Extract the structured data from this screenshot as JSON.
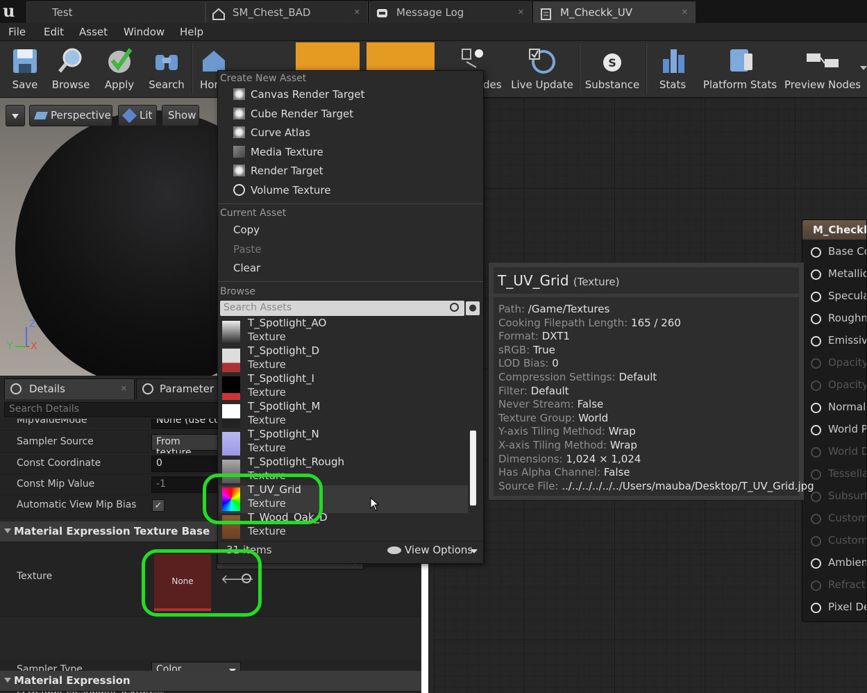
{
  "tabs": [
    {
      "label": "Test",
      "icon": "unreal-logo-icon"
    },
    {
      "label": "SM_Chest_BAD",
      "icon": "static-mesh-icon"
    },
    {
      "label": "Message Log",
      "icon": "message-log-icon"
    },
    {
      "label": "M_Checkk_UV",
      "icon": "material-icon"
    }
  ],
  "menu": [
    "File",
    "Edit",
    "Asset",
    "Window",
    "Help"
  ],
  "toolbar": {
    "save": "Save",
    "browse": "Browse",
    "apply": "Apply",
    "search": "Search",
    "home": "Hor",
    "nodes": "des",
    "live_update": "Live Update",
    "substance": "Substance",
    "stats": "Stats",
    "platform_stats": "Platform Stats",
    "preview_nodes": "Preview Nodes"
  },
  "viewport": {
    "perspective": "Perspective",
    "lit": "Lit",
    "show": "Show",
    "axis_z": "Z",
    "axis_y": "Y",
    "axis_x": "X"
  },
  "details": {
    "tab_details": "Details",
    "tab_params": "Parameter D",
    "search_placeholder": "Search Details",
    "rows": {
      "mip_value_mode": "MipValueMode",
      "mip_value_mode_val": "None (use co",
      "sampler_source": "Sampler Source",
      "sampler_source_val": "From texture",
      "const_coord": "Const Coordinate",
      "const_coord_val": "0",
      "const_mip": "Const Mip Value",
      "const_mip_val": "-1",
      "auto_mip": "Automatic View Mip Bias"
    },
    "section_texture_base": "Material Expression Texture Base",
    "texture_label": "Texture",
    "texture_thumb": "None",
    "texture_combo": "None",
    "sampler_type": "Sampler Type",
    "sampler_type_val": "Color",
    "default_meshpaint": "Is Default Meshpaint Texture",
    "section_expression": "Material Expression"
  },
  "picker": {
    "create_header": "Create New Asset",
    "create_items": [
      "Canvas Render Target",
      "Cube Render Target",
      "Curve Atlas",
      "Media Texture",
      "Render Target",
      "Volume Texture"
    ],
    "current_header": "Current Asset",
    "copy": "Copy",
    "paste": "Paste",
    "clear": "Clear",
    "browse_header": "Browse",
    "search_placeholder": "Search Assets",
    "assets": [
      {
        "name": "T_Spotlight_AO",
        "type": "Texture"
      },
      {
        "name": "T_Spotlight_D",
        "type": "Texture"
      },
      {
        "name": "T_Spotlight_I",
        "type": "Texture"
      },
      {
        "name": "T_Spotlight_M",
        "type": "Texture"
      },
      {
        "name": "T_Spotlight_N",
        "type": "Texture"
      },
      {
        "name": "T_Spotlight_Rough",
        "type": "Texture"
      },
      {
        "name": "T_UV_Grid",
        "type": "Texture"
      },
      {
        "name": "T_Wood_Oak_D",
        "type": "Texture"
      }
    ],
    "count": "31 items",
    "view_options": "View Options"
  },
  "tooltip": {
    "title": "T_UV_Grid",
    "kind": "(Texture)",
    "props": [
      {
        "k": "Path:",
        "v": "/Game/Textures"
      },
      {
        "k": "Cooking Filepath Length:",
        "v": "165 / 260"
      },
      {
        "k": "Format:",
        "v": "DXT1"
      },
      {
        "k": "sRGB:",
        "v": "True"
      },
      {
        "k": "LOD Bias:",
        "v": "0"
      },
      {
        "k": "Compression Settings:",
        "v": "Default"
      },
      {
        "k": "Filter:",
        "v": "Default"
      },
      {
        "k": "Never Stream:",
        "v": "False"
      },
      {
        "k": "Texture Group:",
        "v": "World"
      },
      {
        "k": "Y-axis Tiling Method:",
        "v": "Wrap"
      },
      {
        "k": "X-axis Tiling Method:",
        "v": "Wrap"
      },
      {
        "k": "Dimensions:",
        "v": "1,024 × 1,024"
      },
      {
        "k": "Has Alpha Channel:",
        "v": "False"
      },
      {
        "k": "Source File:",
        "v": "../../../../../../Users/mauba/Desktop/T_UV_Grid.jpg"
      }
    ]
  },
  "node": {
    "title": "M_Checkk",
    "pins": [
      {
        "label": "Base Co",
        "on": true
      },
      {
        "label": "Metallic",
        "on": true
      },
      {
        "label": "Specula",
        "on": true
      },
      {
        "label": "Roughn",
        "on": true
      },
      {
        "label": "Emissiv",
        "on": true
      },
      {
        "label": "Opacity",
        "on": false
      },
      {
        "label": "Opacity",
        "on": false
      },
      {
        "label": "Normal",
        "on": true
      },
      {
        "label": "World Po",
        "on": true
      },
      {
        "label": "World Di",
        "on": false
      },
      {
        "label": "Tessella",
        "on": false
      },
      {
        "label": "Subsurfa",
        "on": false
      },
      {
        "label": "Custom",
        "on": false
      },
      {
        "label": "Custom",
        "on": false
      },
      {
        "label": "Ambient",
        "on": true
      },
      {
        "label": "Refractic",
        "on": false
      },
      {
        "label": "Pixel De",
        "on": true
      }
    ]
  },
  "colors": {
    "highlight": "#22dd22",
    "accent_orange": "#e59a22"
  }
}
